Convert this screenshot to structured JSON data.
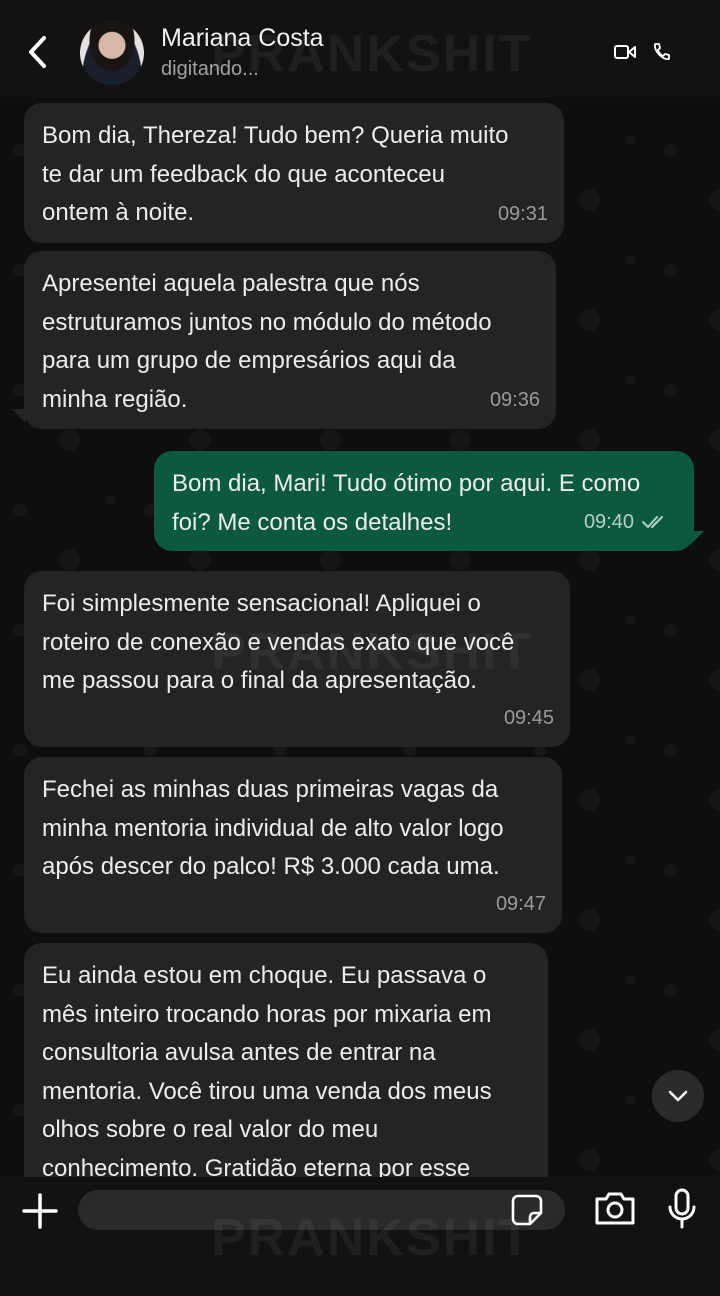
{
  "header": {
    "contact_name": "Mariana Costa",
    "status": "digitando...",
    "icons": [
      "back-chevron-icon",
      "video-call-icon",
      "phone-icon"
    ]
  },
  "watermark": "PRANKSHIT",
  "messages": [
    {
      "direction": "in",
      "text": "Bom dia, Thereza! Tudo bem? Queria muito\nte dar um feedback do que aconteceu\nontem à noite.",
      "time": "09:31"
    },
    {
      "direction": "in",
      "text": "Apresentei aquela palestra que nós\nestruturamos juntos no módulo do método\npara um grupo de empresários aqui da\nminha região.",
      "time": "09:36"
    },
    {
      "direction": "out",
      "text": "Bom dia, Mari! Tudo ótimo por aqui. E como\nfoi? Me conta os detalhes!",
      "time": "09:40",
      "status_icon": "double-check-icon"
    },
    {
      "direction": "in",
      "text": "Foi simplesmente sensacional! Apliquei o\nroteiro de conexão e vendas exato que você\nme passou para o final da apresentação.",
      "time": "09:45"
    },
    {
      "direction": "in",
      "text": "Fechei as minhas duas primeiras vagas da\nminha mentoria individual de alto valor logo\napós descer do palco! R$ 3.000 cada uma.",
      "time": "09:47"
    },
    {
      "direction": "in",
      "text": "Eu ainda estou em choque. Eu passava o\nmês inteiro trocando horas por mixaria em\nconsultoria avulsa antes de entrar na\nmentoria. Você tirou uma venda dos meus\nolhos sobre o real valor do meu\nconhecimento. Gratidão eterna por esse",
      "time": ""
    }
  ],
  "composer": {
    "input_value": "",
    "input_placeholder": "",
    "icons": [
      "plus-icon",
      "sticker-icon",
      "camera-icon",
      "microphone-icon"
    ]
  },
  "colors": {
    "header_bg": "#121212",
    "incoming_bubble": "#242424",
    "outgoing_bubble": "#0b5a40",
    "text": "#ececec",
    "time_text": "#9a9a9a"
  }
}
